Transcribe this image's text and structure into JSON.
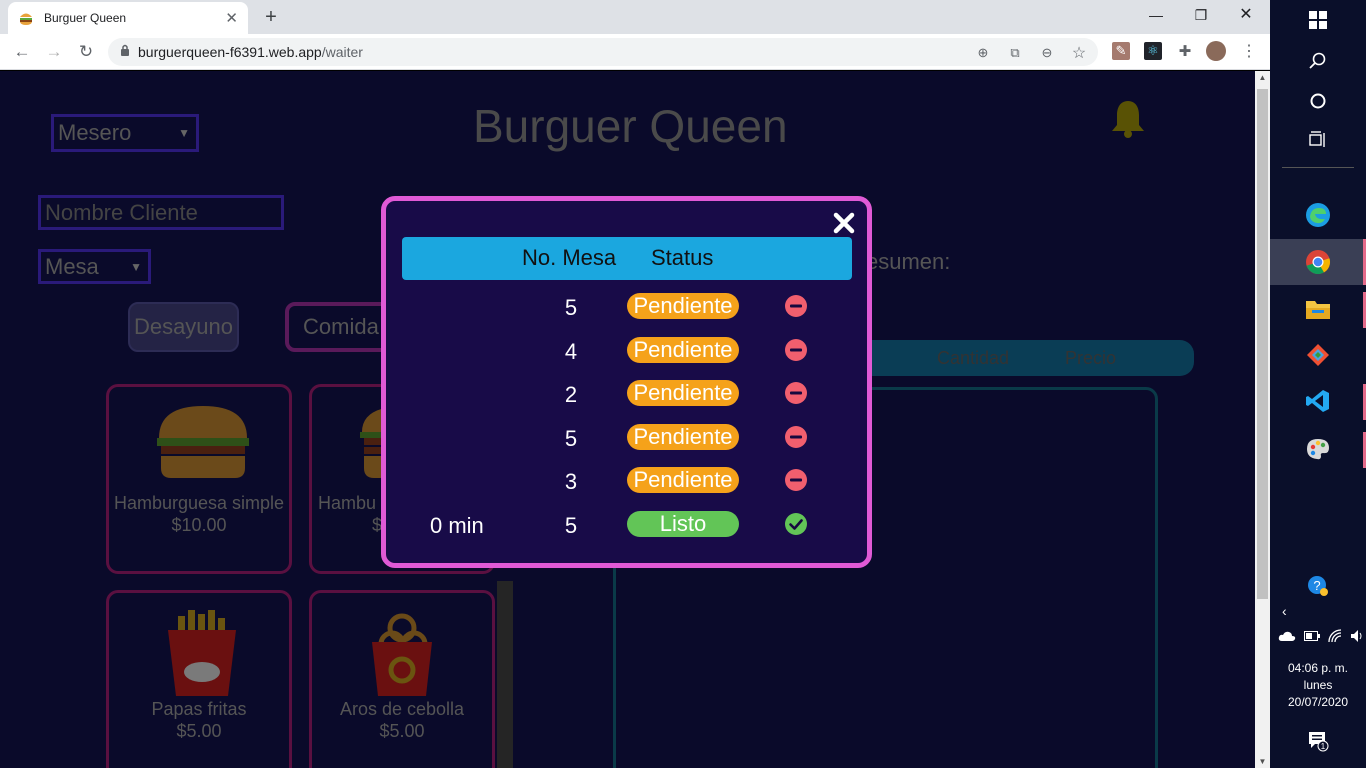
{
  "browser": {
    "tab_title": "Burguer Queen",
    "new_tab": "+",
    "url_domain": "burguerqueen-f6391.web.app",
    "url_path": "/waiter"
  },
  "header": {
    "role_select": "Mesero",
    "title": "Burguer Queen"
  },
  "form": {
    "client_placeholder": "Nombre Cliente",
    "table_select": "Mesa"
  },
  "categories": [
    "Desayuno",
    "Comida"
  ],
  "products": [
    {
      "name": "Hamburguesa simple",
      "price": "$10.00"
    },
    {
      "name": "Hambu",
      "price": "$"
    },
    {
      "name": "Papas fritas",
      "price": "$5.00"
    },
    {
      "name": "Aros de cebolla",
      "price": "$5.00"
    }
  ],
  "summary": {
    "label": "esumen:",
    "col_qty": "Cantidad",
    "col_price": "Precio"
  },
  "modal": {
    "col_table": "No. Mesa",
    "col_status": "Status",
    "orders": [
      {
        "time": "",
        "table": "5",
        "status": "Pendiente",
        "action": "remove"
      },
      {
        "time": "",
        "table": "4",
        "status": "Pendiente",
        "action": "remove"
      },
      {
        "time": "",
        "table": "2",
        "status": "Pendiente",
        "action": "remove"
      },
      {
        "time": "",
        "table": "5",
        "status": "Pendiente",
        "action": "remove"
      },
      {
        "time": "",
        "table": "3",
        "status": "Pendiente",
        "action": "remove"
      },
      {
        "time": "0 min",
        "table": "5",
        "status": "Listo",
        "action": "done"
      }
    ],
    "colors": {
      "pending": "#f5a21a",
      "ready": "#62c557",
      "remove": "#f15f6e",
      "border": "#e05ad6"
    }
  },
  "taskbar": {
    "time": "04:06 p. m.",
    "day": "lunes",
    "date": "20/07/2020",
    "notifications": "1"
  }
}
